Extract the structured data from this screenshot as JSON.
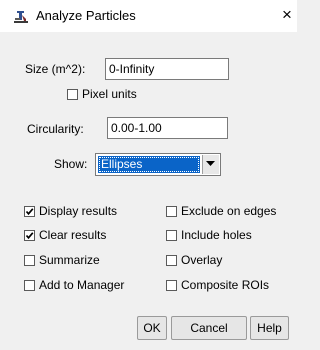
{
  "window": {
    "title": "Analyze Particles",
    "close_glyph": "×"
  },
  "size": {
    "label": "Size (m^2):",
    "value": "0-Infinity"
  },
  "pixel_units": {
    "label": "Pixel units",
    "checked": false
  },
  "circularity": {
    "label": "Circularity:",
    "value": "0.00-1.00"
  },
  "show": {
    "label": "Show:",
    "selected": "Ellipses"
  },
  "options": {
    "display_results": {
      "label": "Display results",
      "checked": true
    },
    "exclude_on_edges": {
      "label": "Exclude on edges",
      "checked": false
    },
    "clear_results": {
      "label": "Clear results",
      "checked": true
    },
    "include_holes": {
      "label": "Include holes",
      "checked": false
    },
    "summarize": {
      "label": "Summarize",
      "checked": false
    },
    "overlay": {
      "label": "Overlay",
      "checked": false
    },
    "add_to_manager": {
      "label": "Add to Manager",
      "checked": false
    },
    "composite_rois": {
      "label": "Composite ROIs",
      "checked": false
    }
  },
  "buttons": {
    "ok": "OK",
    "cancel": "Cancel",
    "help": "Help"
  },
  "colors": {
    "selection": "#0a64c8",
    "background": "#f0f0f0"
  },
  "icons": {
    "app": "imagej-microscope-icon",
    "close": "close-icon",
    "dropdown": "chevron-down-icon"
  }
}
